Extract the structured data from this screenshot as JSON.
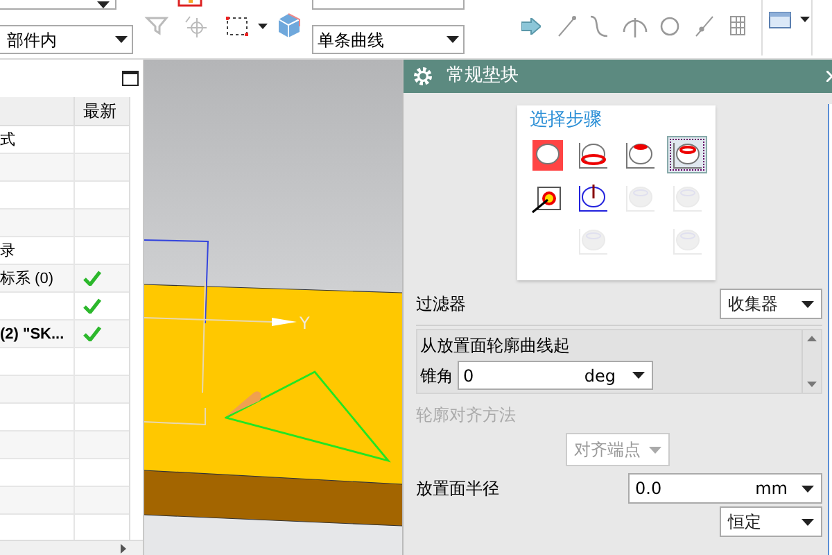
{
  "toolbar": {
    "dropdowns": [
      {
        "value": "部件内"
      },
      {
        "value": "单条曲线"
      }
    ]
  },
  "navigator": {
    "columns": [
      "最新"
    ],
    "rows": [
      {
        "name": "式",
        "latest": false,
        "emphasized": false
      },
      {
        "latest": false
      },
      {
        "latest": false
      },
      {
        "latest": false
      },
      {
        "name": "录",
        "latest": false,
        "emphasized": false
      },
      {
        "name": "标系 (0)",
        "latest": true,
        "emphasized": false
      },
      {
        "latest": true
      },
      {
        "name": "(2) \"SK...",
        "latest": true,
        "emphasized": true
      },
      {
        "latest": false
      },
      {
        "latest": false
      },
      {
        "latest": false
      },
      {
        "latest": false
      },
      {
        "latest": false
      },
      {
        "latest": false
      },
      {
        "latest": false
      }
    ]
  },
  "viewport": {
    "axis_label": "Y"
  },
  "dialog": {
    "title": "常规垫块",
    "steps": {
      "title": "选择步骤",
      "items": [
        {
          "kind": "face",
          "selected": false,
          "disabled": false
        },
        {
          "kind": "edge",
          "selected": false,
          "disabled": false
        },
        {
          "kind": "top",
          "selected": false,
          "disabled": false
        },
        {
          "kind": "profile",
          "selected": true,
          "disabled": false
        },
        {
          "kind": "target",
          "selected": false,
          "disabled": false
        },
        {
          "kind": "direction",
          "selected": false,
          "disabled": false
        },
        {
          "kind": "solid",
          "selected": false,
          "disabled": true
        },
        {
          "kind": "solid",
          "selected": false,
          "disabled": true
        },
        {
          "kind": "blank"
        },
        {
          "kind": "solid",
          "selected": false,
          "disabled": true
        },
        {
          "kind": "blank"
        },
        {
          "kind": "solid",
          "selected": false,
          "disabled": true
        }
      ]
    },
    "filter": {
      "label": "过滤器",
      "value": "收集器"
    },
    "group": {
      "title": "从放置面轮廓曲线起",
      "taper_label": "锥角",
      "taper_value": "0",
      "taper_unit": "deg"
    },
    "align": {
      "label": "轮廓对齐方法",
      "value": "对齐端点",
      "disabled": true
    },
    "radius": {
      "label": "放置面半径",
      "value": "0.0",
      "unit": "mm",
      "mode": "恒定"
    }
  }
}
